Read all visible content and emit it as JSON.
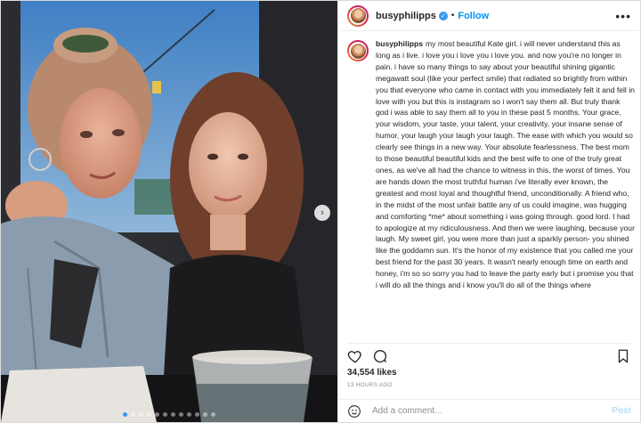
{
  "header": {
    "username": "busyphilipps",
    "separator": "•",
    "follow_label": "Follow",
    "more_label": "•••"
  },
  "caption": {
    "username": "busyphilipps",
    "text": "my most beautiful Kate girl. i will never understand this as long as i live. i love you i love you i love you. and now you're no longer in pain. i have so many things to say about your beautiful shining gigantic megawatt soul (like your perfect smile) that radiated so brightly from within you that everyone who came in contact with you immediately felt it and fell in love with you but this is instagram so i won't say them all. But truly thank god i was able to say them all to you in these past 5 months. Your grace, your wisdom, your taste, your talent, your creativity, your insane sense of humor, your laugh your laugh your laugh. The ease with which you would so clearly see things in a new way. Your absolute fearlessness. The best mom to those beautiful beautiful kids and the best wife to one of the truly great ones, as we've all had the chance to witness in this, the worst of times. You are hands down the most truthful human i've literally ever known, the greatest and most loyal and thoughtful friend, unconditionally. A friend who, in the midst of the most unfair battle any of us could imagine, was hugging and comforting *me* about something i was going through. good lord. I had to apologize at my ridiculousness. And then we were laughing, because your laugh. My sweet girl, you were more than just a sparkly person- you shined like the goddamn sun. It's the honor of my existence that you called me your best friend for the past 30 years. It wasn't nearly enough time on earth and honey, i'm so so sorry you had to leave the party early but i promise you that i will do all the things and i know you'll do all of the things where"
  },
  "stats": {
    "likes": "34,554 likes",
    "time_ago": "13 HOURS AGO"
  },
  "comment": {
    "placeholder": "Add a comment...",
    "post_label": "Post"
  },
  "carousel": {
    "next_label": "›",
    "slide_count": 12,
    "active_index": 0
  },
  "icons": {
    "like": "heart-icon",
    "comment": "comment-icon",
    "save": "bookmark-icon",
    "emoji": "smiley-icon",
    "verified": "verified-badge-icon"
  },
  "colors": {
    "accent": "#0095f6",
    "verified": "#3897f0",
    "muted": "#8e8e8e",
    "post_disabled": "#b2dffc"
  }
}
